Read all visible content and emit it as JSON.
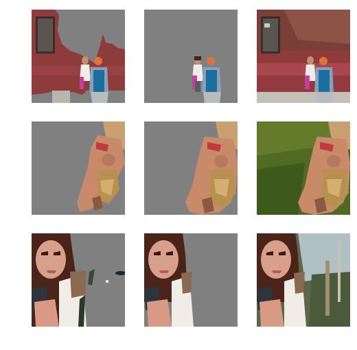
{
  "figure": {
    "rows": [
      {
        "subject": "two-people-brick-wall",
        "tiles": [
          {
            "kind": "predicted-mask",
            "icon": "segmentation-mask-icon"
          },
          {
            "kind": "refined-mask",
            "icon": "segmentation-mask-icon"
          },
          {
            "kind": "original-photo",
            "icon": "photo-icon"
          }
        ]
      },
      {
        "subject": "woman-lying-on-grass",
        "tiles": [
          {
            "kind": "predicted-mask",
            "icon": "segmentation-mask-icon"
          },
          {
            "kind": "refined-mask",
            "icon": "segmentation-mask-icon"
          },
          {
            "kind": "original-photo",
            "icon": "photo-icon"
          }
        ]
      },
      {
        "subject": "woman-with-phone",
        "tiles": [
          {
            "kind": "predicted-mask",
            "icon": "segmentation-mask-icon"
          },
          {
            "kind": "refined-mask",
            "icon": "segmentation-mask-icon"
          },
          {
            "kind": "original-photo",
            "icon": "photo-icon"
          }
        ]
      }
    ],
    "colors": {
      "mask_gray": "#808080",
      "brick": "#8e3b3c",
      "grass": "#4f6a22",
      "skin": "#c98a6a",
      "hair": "#6a3a24",
      "blue_backpack": "#1b6f9e"
    }
  }
}
